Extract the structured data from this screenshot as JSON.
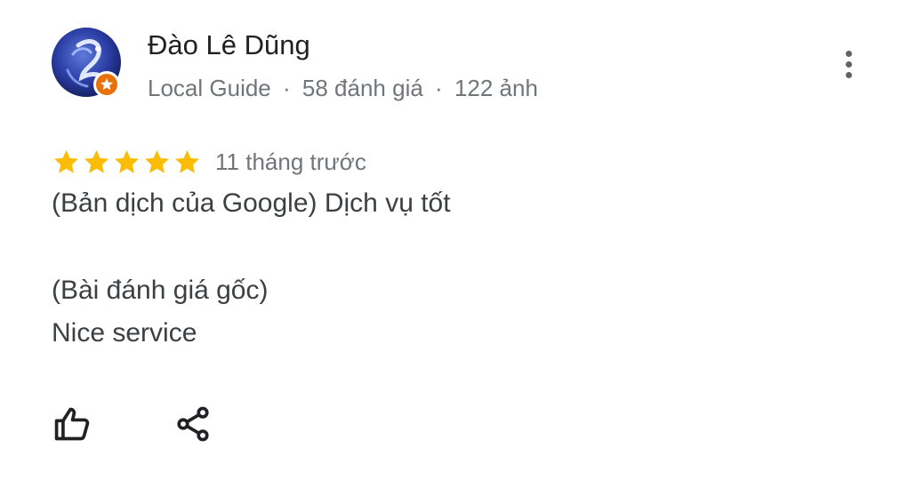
{
  "review": {
    "author": {
      "name": "Đào Lê Dũng",
      "badge": "Local Guide",
      "reviews_count": "58 đánh giá",
      "photos_count": "122 ảnh",
      "separator": "·",
      "badge_color": "#e8710a"
    },
    "rating": 5,
    "rating_max": 5,
    "star_color": "#fbbc04",
    "time": "11 tháng trước",
    "translated_text": "(Bản dịch của Google) Dịch vụ tốt",
    "original_label": "(Bài đánh giá gốc)",
    "original_text": "Nice service"
  },
  "actions": {
    "more_icon": "more-vert-icon",
    "like_icon": "thumb-up-icon",
    "share_icon": "share-icon"
  }
}
